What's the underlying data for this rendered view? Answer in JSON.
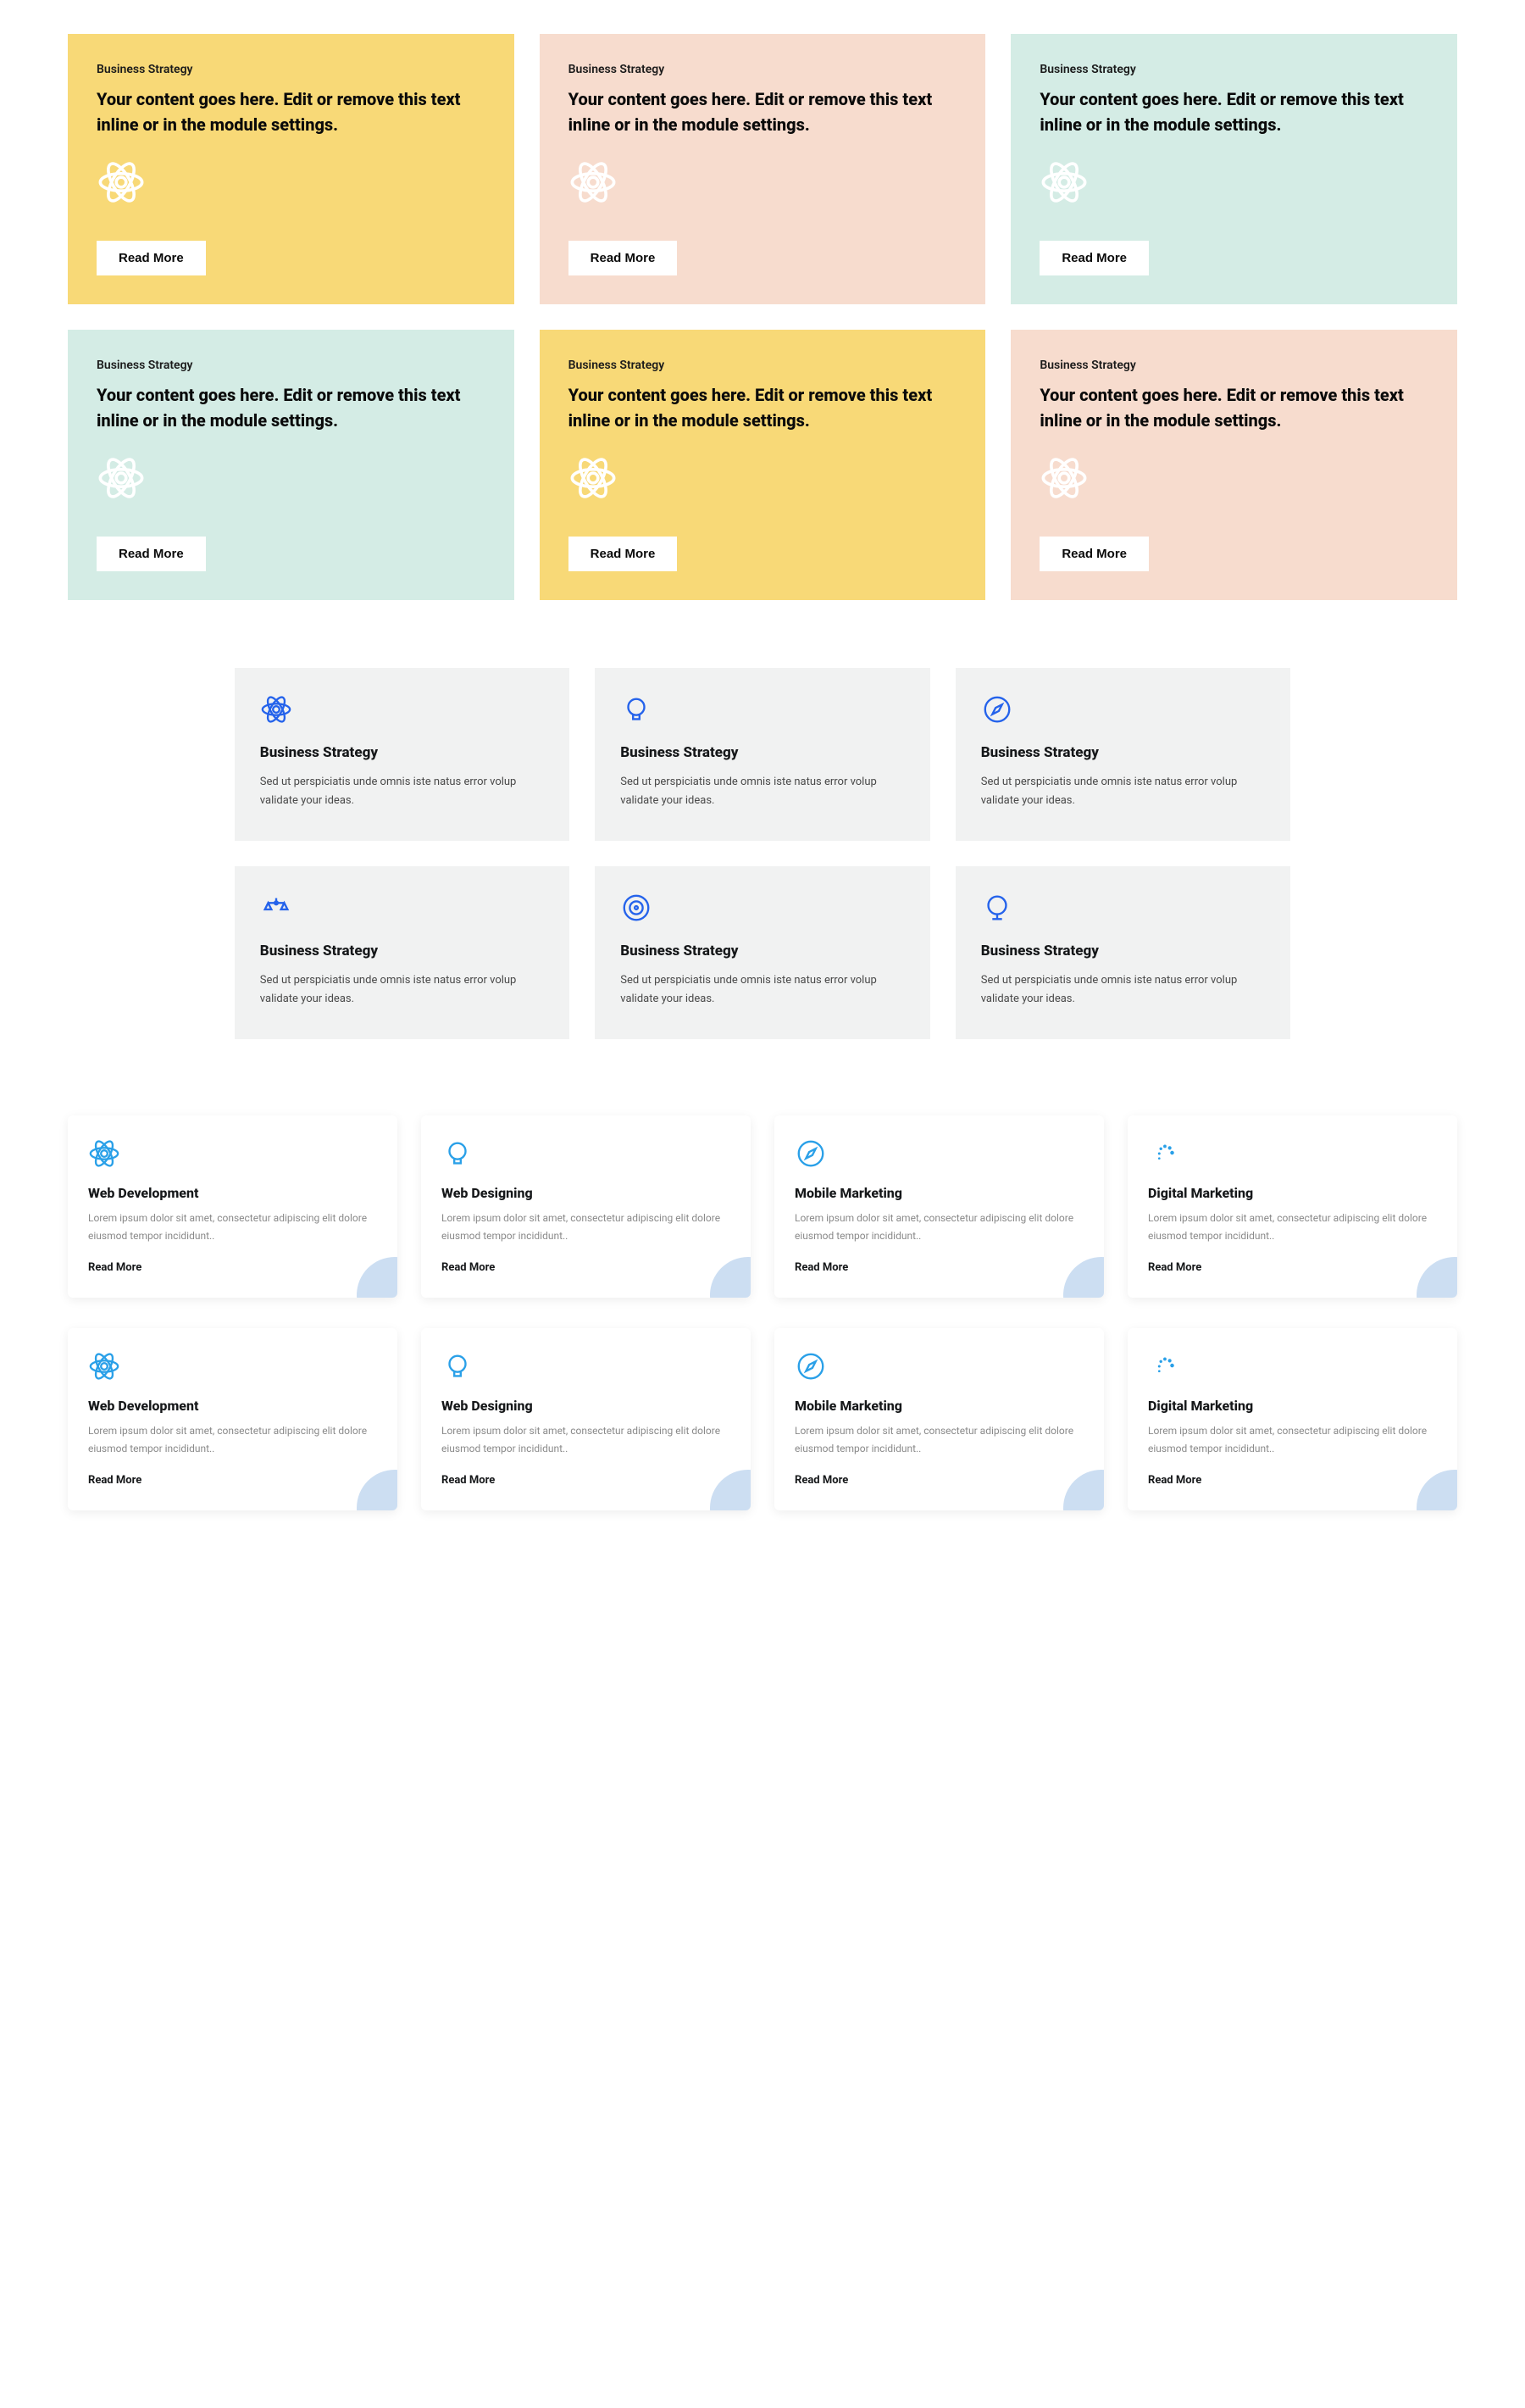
{
  "section1": {
    "cards": [
      {
        "category": "Business Strategy",
        "title": "Your content goes here. Edit or remove this text inline or in the module settings.",
        "button": "Read More"
      },
      {
        "category": "Business Strategy",
        "title": "Your content goes here. Edit or remove this text inline or in the module settings.",
        "button": "Read More"
      },
      {
        "category": "Business Strategy",
        "title": "Your content goes here. Edit or remove this text inline or in the module settings.",
        "button": "Read More"
      },
      {
        "category": "Business Strategy",
        "title": "Your content goes here. Edit or remove this text inline or in the module settings.",
        "button": "Read More"
      },
      {
        "category": "Business Strategy",
        "title": "Your content goes here. Edit or remove this text inline or in the module settings.",
        "button": "Read More"
      },
      {
        "category": "Business Strategy",
        "title": "Your content goes here. Edit or remove this text inline or in the module settings.",
        "button": "Read More"
      }
    ]
  },
  "section2": {
    "cards": [
      {
        "title": "Business Strategy",
        "desc": "Sed ut perspiciatis unde omnis iste natus error volup validate your ideas."
      },
      {
        "title": "Business Strategy",
        "desc": "Sed ut perspiciatis unde omnis iste natus error volup validate your ideas."
      },
      {
        "title": "Business Strategy",
        "desc": "Sed ut perspiciatis unde omnis iste natus error volup validate your ideas."
      },
      {
        "title": "Business Strategy",
        "desc": "Sed ut perspiciatis unde omnis iste natus error volup validate your ideas."
      },
      {
        "title": "Business Strategy",
        "desc": "Sed ut perspiciatis unde omnis iste natus error volup validate your ideas."
      },
      {
        "title": "Business Strategy",
        "desc": "Sed ut perspiciatis unde omnis iste natus error volup validate your ideas."
      }
    ]
  },
  "section3": {
    "cards": [
      {
        "title": "Web Development",
        "desc": "Lorem ipsum dolor sit amet, consectetur adipiscing elit dolore eiusmod tempor incididunt..",
        "more": "Read More"
      },
      {
        "title": "Web Designing",
        "desc": "Lorem ipsum dolor sit amet, consectetur adipiscing elit dolore eiusmod tempor incididunt..",
        "more": "Read More"
      },
      {
        "title": "Mobile Marketing",
        "desc": "Lorem ipsum dolor sit amet, consectetur adipiscing elit dolore eiusmod tempor incididunt..",
        "more": "Read More"
      },
      {
        "title": "Digital Marketing",
        "desc": "Lorem ipsum dolor sit amet, consectetur adipiscing elit dolore eiusmod tempor incididunt..",
        "more": "Read More"
      },
      {
        "title": "Web Development",
        "desc": "Lorem ipsum dolor sit amet, consectetur adipiscing elit dolore eiusmod tempor incididunt..",
        "more": "Read More"
      },
      {
        "title": "Web Designing",
        "desc": "Lorem ipsum dolor sit amet, consectetur adipiscing elit dolore eiusmod tempor incididunt..",
        "more": "Read More"
      },
      {
        "title": "Mobile Marketing",
        "desc": "Lorem ipsum dolor sit amet, consectetur adipiscing elit dolore eiusmod tempor incididunt..",
        "more": "Read More"
      },
      {
        "title": "Digital Marketing",
        "desc": "Lorem ipsum dolor sit amet, consectetur adipiscing elit dolore eiusmod tempor incididunt..",
        "more": "Read More"
      }
    ]
  }
}
